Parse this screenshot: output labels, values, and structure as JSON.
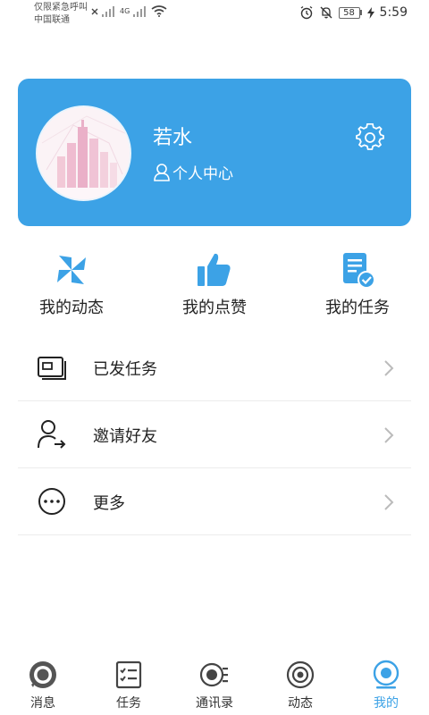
{
  "status_bar": {
    "carrier_line1": "仅限紧急呼叫",
    "carrier_line2": "中国联通",
    "network": "4G",
    "battery": "58",
    "time": "5:59"
  },
  "profile": {
    "name": "若水",
    "center_label": "个人中心"
  },
  "quick_actions": [
    {
      "label": "我的动态",
      "icon": "pinwheel-icon"
    },
    {
      "label": "我的点赞",
      "icon": "thumbs-up-icon"
    },
    {
      "label": "我的任务",
      "icon": "task-document-icon"
    }
  ],
  "menu": [
    {
      "label": "已发任务",
      "icon": "sent-tasks-icon"
    },
    {
      "label": "邀请好友",
      "icon": "invite-user-icon"
    },
    {
      "label": "更多",
      "icon": "more-icon"
    }
  ],
  "bottom_nav": [
    {
      "label": "消息",
      "icon": "message-icon",
      "active": false
    },
    {
      "label": "任务",
      "icon": "task-list-icon",
      "active": false
    },
    {
      "label": "通讯录",
      "icon": "contacts-icon",
      "active": false
    },
    {
      "label": "动态",
      "icon": "moments-icon",
      "active": false
    },
    {
      "label": "我的",
      "icon": "profile-icon",
      "active": true
    }
  ],
  "colors": {
    "accent": "#3ca2e6",
    "text": "#222222",
    "divider": "#ececec"
  }
}
